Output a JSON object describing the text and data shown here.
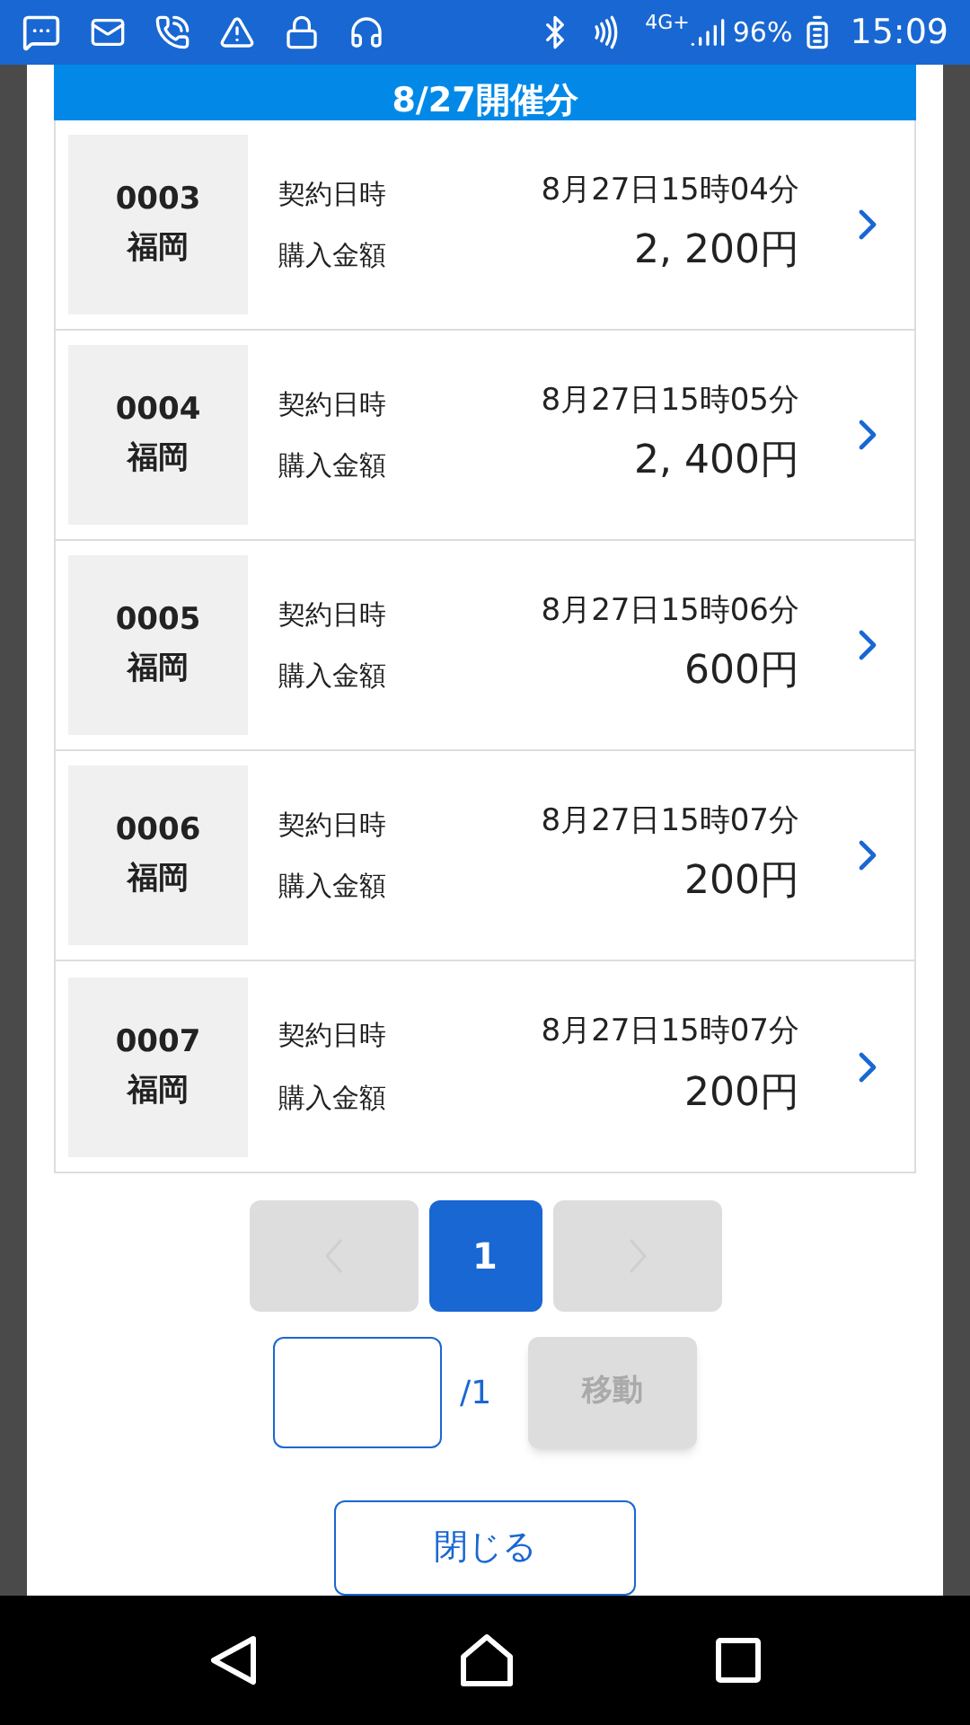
{
  "status_bar": {
    "network": "4G+",
    "battery": "96%",
    "time": "15:09"
  },
  "header": {
    "title": "8/27開催分"
  },
  "contracts": [
    {
      "number": "0003",
      "place": "福岡",
      "datetime_label": "契約日時",
      "datetime": "8月27日15時04分",
      "amount_label": "購入金額",
      "amount": "2, 200円"
    },
    {
      "number": "0004",
      "place": "福岡",
      "datetime_label": "契約日時",
      "datetime": "8月27日15時05分",
      "amount_label": "購入金額",
      "amount": "2, 400円"
    },
    {
      "number": "0005",
      "place": "福岡",
      "datetime_label": "契約日時",
      "datetime": "8月27日15時06分",
      "amount_label": "購入金額",
      "amount": "600円"
    },
    {
      "number": "0006",
      "place": "福岡",
      "datetime_label": "契約日時",
      "datetime": "8月27日15時07分",
      "amount_label": "購入金額",
      "amount": "200円"
    },
    {
      "number": "0007",
      "place": "福岡",
      "datetime_label": "契約日時",
      "datetime": "8月27日15時07分",
      "amount_label": "購入金額",
      "amount": "200円"
    }
  ],
  "pagination": {
    "prev_disabled": true,
    "next_disabled": true,
    "pages": [
      {
        "label": "1",
        "selected": true
      }
    ]
  },
  "jump": {
    "total": "/1",
    "move_button": {
      "label": "移動",
      "disabled": true
    }
  },
  "close_button": {
    "label": "閉じる"
  }
}
